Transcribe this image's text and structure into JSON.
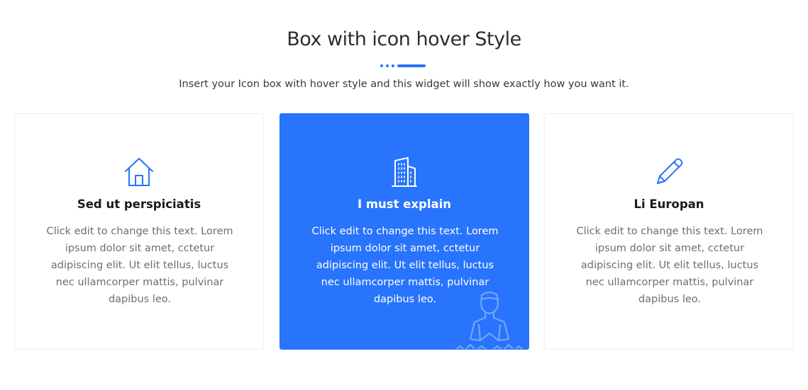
{
  "header": {
    "title": "Box with icon hover Style",
    "subtitle": "Insert your Icon box with hover style and this widget will show exactly how you want it."
  },
  "colors": {
    "accent": "#2874fc",
    "title_text": "#2d2d2d",
    "body_text": "#6e6e6e"
  },
  "cards": [
    {
      "icon": "house-icon",
      "title": "Sed ut perspiciatis",
      "text": "Click edit to change this text. Lorem ipsum dolor sit amet, cctetur adipiscing elit. Ut elit tellus, luctus nec ullamcorper mattis, pulvinar dapibus leo.",
      "active": false
    },
    {
      "icon": "building-icon",
      "title": "I must explain",
      "text": "Click edit to change this text. Lorem ipsum dolor sit amet, cctetur adipiscing elit. Ut elit tellus, luctus nec ullamcorper mattis, pulvinar dapibus leo.",
      "active": true,
      "watermark_icon": "meditating-person-icon"
    },
    {
      "icon": "pencil-icon",
      "title": "Li Europan",
      "text": "Click edit to change this text. Lorem ipsum dolor sit amet, cctetur adipiscing elit. Ut elit tellus, luctus nec ullamcorper mattis, pulvinar dapibus leo.",
      "active": false
    }
  ]
}
